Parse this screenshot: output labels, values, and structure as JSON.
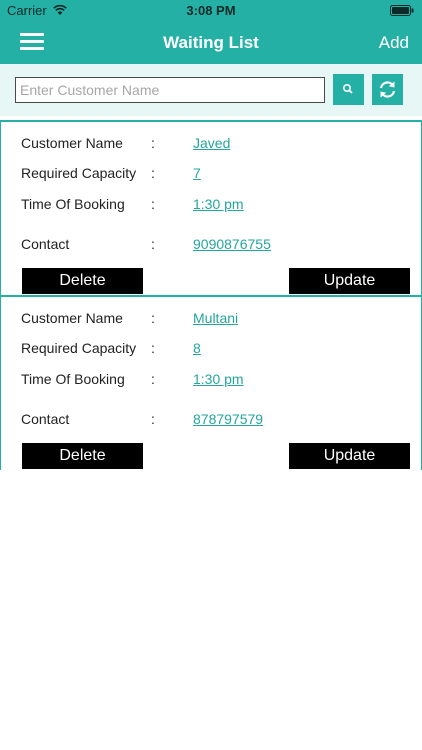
{
  "status_bar": {
    "carrier": "Carrier",
    "time": "3:08 PM"
  },
  "nav": {
    "title": "Waiting List",
    "add_label": "Add",
    "menu_icon": "hamburger-menu-icon"
  },
  "search": {
    "placeholder": "Enter Customer Name",
    "value": "",
    "search_icon": "search-icon",
    "refresh_icon": "refresh-icon"
  },
  "colors": {
    "accent": "#25b0a6",
    "link": "#25a69c",
    "button_bg": "#000000"
  },
  "labels": {
    "customer_name": "Customer Name",
    "required_capacity": "Required Capacity",
    "time_of_booking": "Time Of Booking",
    "contact": "Contact",
    "colon": ":",
    "delete": "Delete",
    "update": "Update"
  },
  "entries": [
    {
      "customer_name": "Javed",
      "required_capacity": "7",
      "time_of_booking": "1:30 pm",
      "contact": "9090876755"
    },
    {
      "customer_name": "Multani",
      "required_capacity": "8",
      "time_of_booking": "1:30 pm",
      "contact": "878797579"
    }
  ]
}
